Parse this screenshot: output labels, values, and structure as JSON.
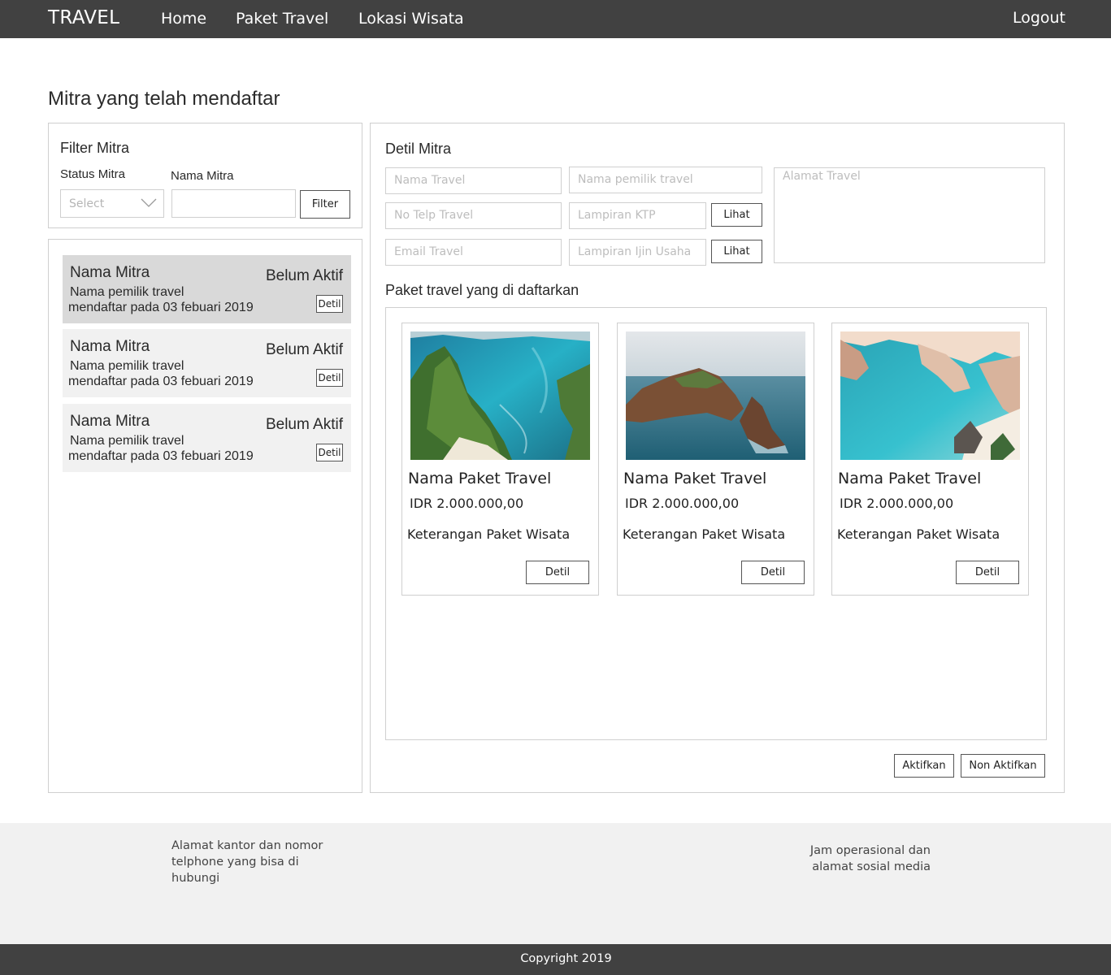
{
  "nav": {
    "brand": "TRAVEL",
    "items": [
      {
        "label": "Home"
      },
      {
        "label": "Paket Travel"
      },
      {
        "label": "Lokasi Wisata"
      }
    ],
    "logout": "Logout"
  },
  "page_title": "Mitra yang telah mendaftar",
  "filter": {
    "title": "Filter Mitra",
    "status_label": "Status Mitra",
    "status_placeholder": "Select",
    "name_label": "Nama Mitra",
    "name_value": "",
    "button": "Filter"
  },
  "mitra_list": [
    {
      "name": "Nama Mitra",
      "status": "Belum Aktif",
      "owner": "Nama pemilik travel",
      "registered": "mendaftar pada 03 febuari 2019",
      "detail": "Detil",
      "selected": true
    },
    {
      "name": "Nama Mitra",
      "status": "Belum Aktif",
      "owner": "Nama pemilik travel",
      "registered": "mendaftar pada 03 febuari 2019",
      "detail": "Detil",
      "selected": false
    },
    {
      "name": "Nama Mitra",
      "status": "Belum Aktif",
      "owner": "Nama pemilik travel",
      "registered": "mendaftar pada 03 febuari 2019",
      "detail": "Detil",
      "selected": false
    }
  ],
  "detail": {
    "title": "Detil Mitra",
    "fields": {
      "nama_travel": "Nama Travel",
      "nama_pemilik": "Nama pemilik travel",
      "alamat": "Alamat Travel",
      "no_telp": "No Telp Travel",
      "lampiran_ktp": "Lampiran KTP",
      "email": "Email Travel",
      "lampiran_ijin": "Lampiran Ijin Usaha"
    },
    "lihat_label": "Lihat",
    "paket_title": "Paket travel yang di daftarkan",
    "activate": "Aktifkan",
    "deactivate": "Non Aktifkan"
  },
  "paket": [
    {
      "name": "Nama Paket Travel",
      "price": "IDR 2.000.000,00",
      "desc": "Keterangan Paket Wisata",
      "detail": "Detil"
    },
    {
      "name": "Nama Paket Travel",
      "price": "IDR 2.000.000,00",
      "desc": "Keterangan Paket Wisata",
      "detail": "Detil"
    },
    {
      "name": "Nama Paket Travel",
      "price": "IDR 2.000.000,00",
      "desc": "Keterangan Paket Wisata",
      "detail": "Detil"
    }
  ],
  "footer": {
    "left": "Alamat kantor dan nomor telphone yang bisa di hubungi",
    "right": "Jam operasional dan alamat sosial media",
    "copyright": "Copyright 2019"
  },
  "colors": {
    "topbar": "#414141",
    "footer_bg": "#f1f1f1",
    "card_selected": "#d9d9d9",
    "card": "#f1f1f1",
    "border": "#cfcfcf"
  }
}
